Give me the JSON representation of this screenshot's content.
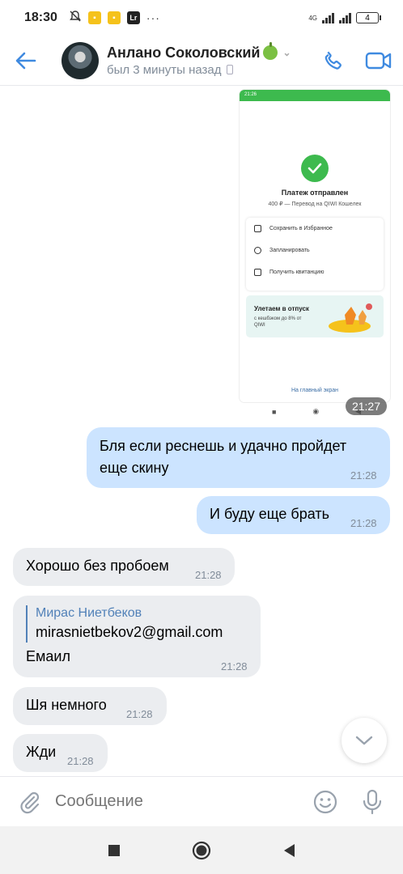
{
  "status_bar": {
    "time": "18:30",
    "lr_label": "Lr",
    "dots": "···",
    "network": "4G",
    "battery": "4"
  },
  "header": {
    "contact_name": "Анлано Соколовский",
    "contact_status": "был 3 минуты назад"
  },
  "screenshot": {
    "status_time": "21:26",
    "title": "Платеж отправлен",
    "subtitle": "400 ₽ — Перевод на QIWI Кошелек",
    "actions": [
      "Сохранить в Избранное",
      "Запланировать",
      "Получить квитанцию"
    ],
    "banner_title": "Улетаем в отпуск",
    "banner_text": "с кешбэком до 8% от QIWI",
    "home_link": "На главный экран",
    "time": "21:27"
  },
  "messages": [
    {
      "direction": "out",
      "text": "Бля если реснешь и удачно пройдет еще скину",
      "time": "21:28"
    },
    {
      "direction": "out",
      "text": "И буду еще брать",
      "time": "21:28"
    },
    {
      "direction": "in",
      "text": "Хорошо без пробоем",
      "time": "21:28"
    },
    {
      "direction": "in",
      "reply_name": "Мирас Ниетбеков",
      "reply_text": "mirasnietbekov2@gmail.com",
      "text": "Емаил",
      "time": "21:28"
    },
    {
      "direction": "in",
      "text": "Шя немного",
      "time": "21:28"
    },
    {
      "direction": "in",
      "text": "Жди",
      "time": "21:28"
    }
  ],
  "composer": {
    "placeholder": "Сообщение"
  },
  "colors": {
    "accent": "#3f8ae0",
    "outgoing_bubble": "#cce4ff",
    "incoming_bubble": "#ebedf0",
    "qiwi_green": "#3dba4e"
  },
  "icons": {
    "back": "arrow-left-icon",
    "call": "phone-icon",
    "video": "video-camera-icon",
    "attach": "paperclip-icon",
    "emoji": "smile-icon",
    "mic": "microphone-icon",
    "scroll_down": "chevron-down-icon"
  }
}
